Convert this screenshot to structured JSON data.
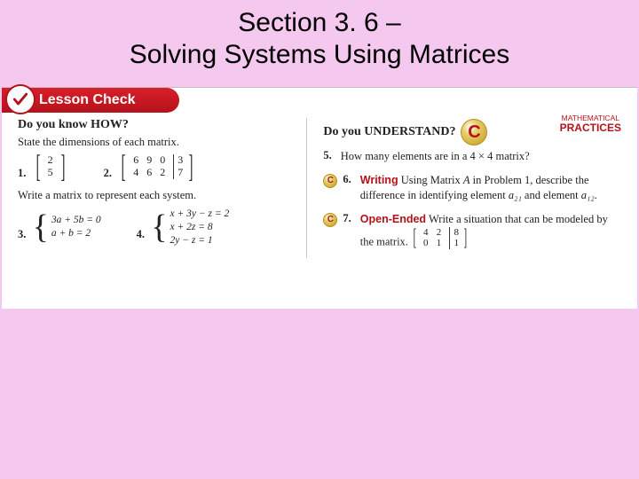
{
  "header": {
    "line1": "Section 3. 6 –",
    "line2": "Solving Systems Using Matrices"
  },
  "banner": "Lesson Check",
  "left": {
    "heading": "Do you know HOW?",
    "instr1": "State the dimensions of each matrix.",
    "q1": {
      "num": "1.",
      "rows": [
        "2",
        "5"
      ]
    },
    "q2": {
      "num": "2.",
      "rows": [
        [
          "6",
          "9",
          "0",
          "3"
        ],
        [
          "4",
          "6",
          "2",
          "7"
        ]
      ]
    },
    "instr2": "Write a matrix to represent each system.",
    "q3": {
      "num": "3.",
      "line1": "3a + 5b = 0",
      "line2": " a +   b = 2"
    },
    "q4": {
      "num": "4.",
      "line1": "x + 3y − z = 2",
      "line2": "x + 2z = 8",
      "line3": "2y − z = 1"
    }
  },
  "right": {
    "heading": "Do you UNDERSTAND?",
    "mp1": "MATHEMATICAL",
    "mp2": "PRACTICES",
    "q5": {
      "num": "5.",
      "text": "How many elements are in a 4 × 4 matrix?"
    },
    "q6": {
      "num": "6.",
      "term": "Writing",
      "textA": "Using Matrix ",
      "A": "A",
      "textB": " in Problem 1, describe the difference in identifying element ",
      "a21": "a₂₁",
      "textC": " and element ",
      "a12": "a₁₂",
      "textD": "."
    },
    "q7": {
      "num": "7.",
      "term": "Open-Ended",
      "textA": "Write a situation that can be modeled by the matrix.",
      "rows": [
        [
          "4",
          "2",
          "8"
        ],
        [
          "0",
          "1",
          "1"
        ]
      ]
    }
  }
}
